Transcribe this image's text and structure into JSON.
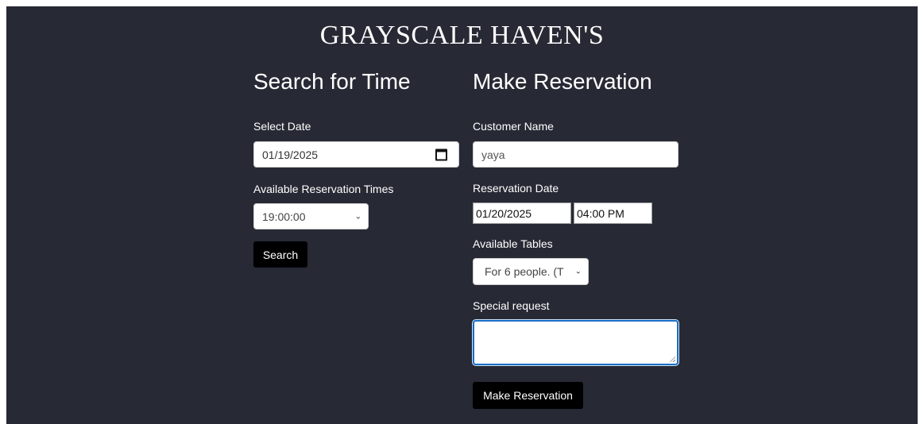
{
  "header": {
    "title": "GRAYSCALE HAVEN'S"
  },
  "search": {
    "title": "Search for Time",
    "date_label": "Select Date",
    "date_value": "01/19/2025",
    "times_label": "Available Reservation Times",
    "time_value": "19:00:00",
    "search_button": "Search"
  },
  "reservation": {
    "title": "Make Reservation",
    "name_label": "Customer Name",
    "name_value": "yaya",
    "date_label": "Reservation Date",
    "date_value": "01/20/2025",
    "time_value": "04:00 PM",
    "tables_label": "Available Tables",
    "table_value": "For 6 people. (T",
    "request_label": "Special request",
    "request_value": "",
    "submit_button": "Make Reservation"
  },
  "colors": {
    "background": "#272a35",
    "button": "#000000",
    "focus": "#1a6fc7"
  }
}
